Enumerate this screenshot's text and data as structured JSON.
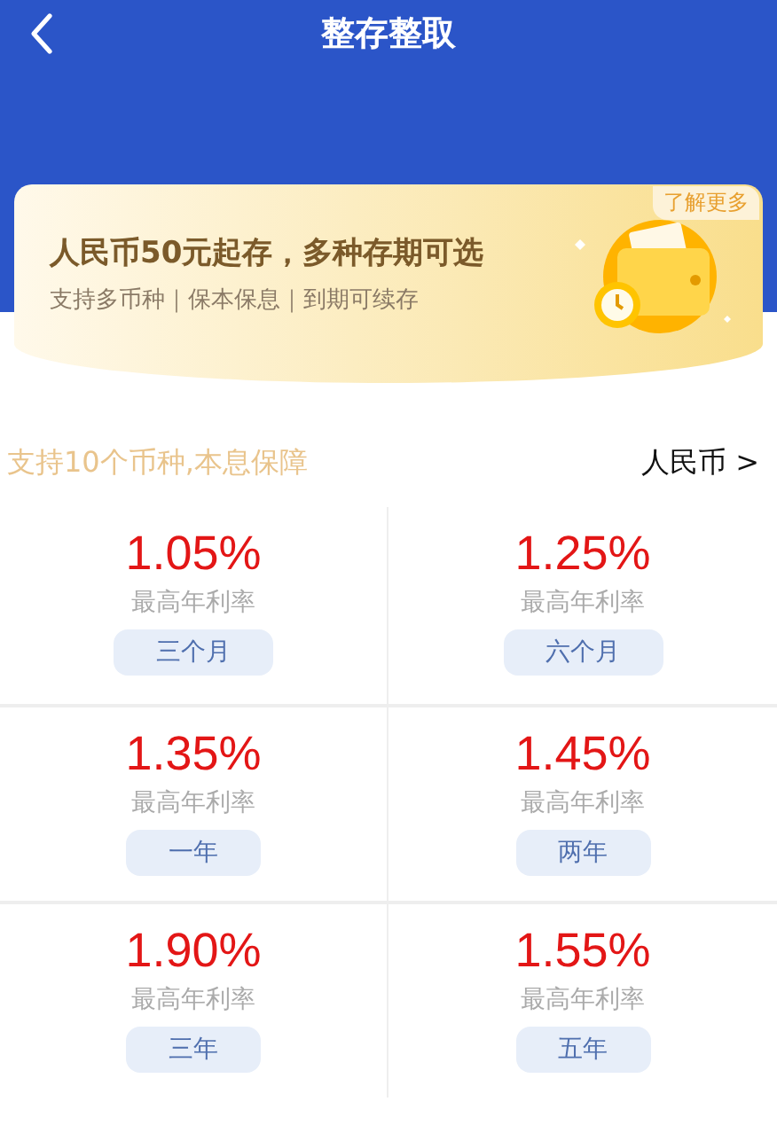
{
  "title": "整存整取",
  "banner": {
    "more": "了解更多",
    "headline": "人民币50元起存，多种存期可选",
    "subline": "支持多币种｜保本保息｜到期可续存"
  },
  "currency": {
    "note": "支持10个币种,本息保障",
    "selector": "人民币 >"
  },
  "products": [
    {
      "rate": "1.05%",
      "rate_label": "最高年利率",
      "term": "三个月"
    },
    {
      "rate": "1.25%",
      "rate_label": "最高年利率",
      "term": "六个月"
    },
    {
      "rate": "1.35%",
      "rate_label": "最高年利率",
      "term": "一年"
    },
    {
      "rate": "1.45%",
      "rate_label": "最高年利率",
      "term": "两年"
    },
    {
      "rate": "1.90%",
      "rate_label": "最高年利率",
      "term": "三年"
    },
    {
      "rate": "1.55%",
      "rate_label": "最高年利率",
      "term": "五年"
    }
  ]
}
